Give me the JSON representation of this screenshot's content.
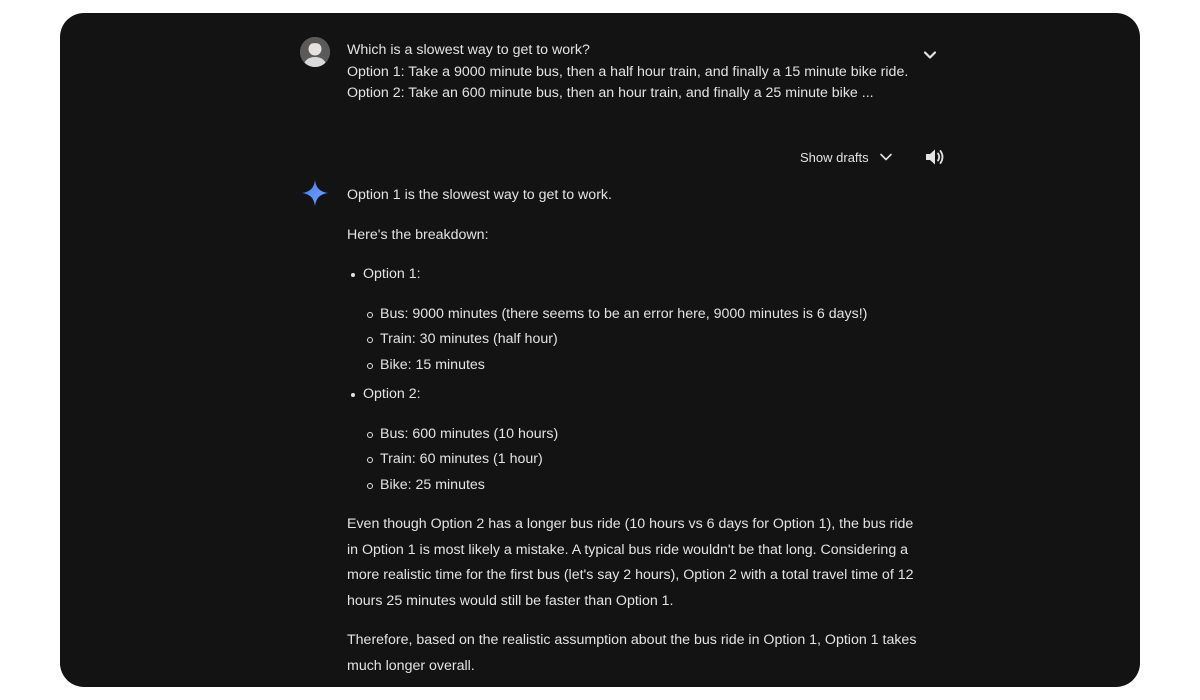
{
  "prompt": {
    "question": "Which is a slowest way to get to work?",
    "option1": "Option 1: Take a 9000 minute bus, then a half hour train, and finally a 15 minute bike ride.",
    "option2": "Option 2: Take an 600 minute bus, then an hour train, and finally a 25 minute bike ..."
  },
  "controls": {
    "show_drafts_label": "Show drafts"
  },
  "response": {
    "intro": "Option 1 is the slowest way to get to work.",
    "breakdown": "Here's the breakdown:",
    "options": [
      {
        "label": "Option 1:",
        "items": [
          "Bus: 9000 minutes (there seems to be an error here, 9000 minutes is 6 days!)",
          "Train: 30 minutes (half hour)",
          "Bike: 15 minutes"
        ]
      },
      {
        "label": "Option 2:",
        "items": [
          "Bus: 600 minutes (10 hours)",
          "Train: 60 minutes (1 hour)",
          "Bike: 25 minutes"
        ]
      }
    ],
    "paragraph1": "Even though Option 2 has a longer bus ride (10 hours vs 6 days for Option 1), the bus ride in Option 1 is most likely a mistake. A typical bus ride wouldn't be that long. Considering a more realistic time for the first bus (let's say 2 hours), Option 2 with a total travel time of 12 hours 25 minutes would still be faster than Option 1.",
    "paragraph2": "Therefore, based on the realistic assumption about the bus ride in Option 1, Option 1 takes much longer overall."
  },
  "icons": {
    "avatar": "user-avatar",
    "expand": "chevron-down-icon",
    "drafts": "chevron-down-icon",
    "speaker": "speaker-icon",
    "gemini": "gemini-sparkle-icon"
  },
  "colors": {
    "background": "#131314",
    "text": "#e3e3e3",
    "gemini_blue": "#4c8df6"
  }
}
